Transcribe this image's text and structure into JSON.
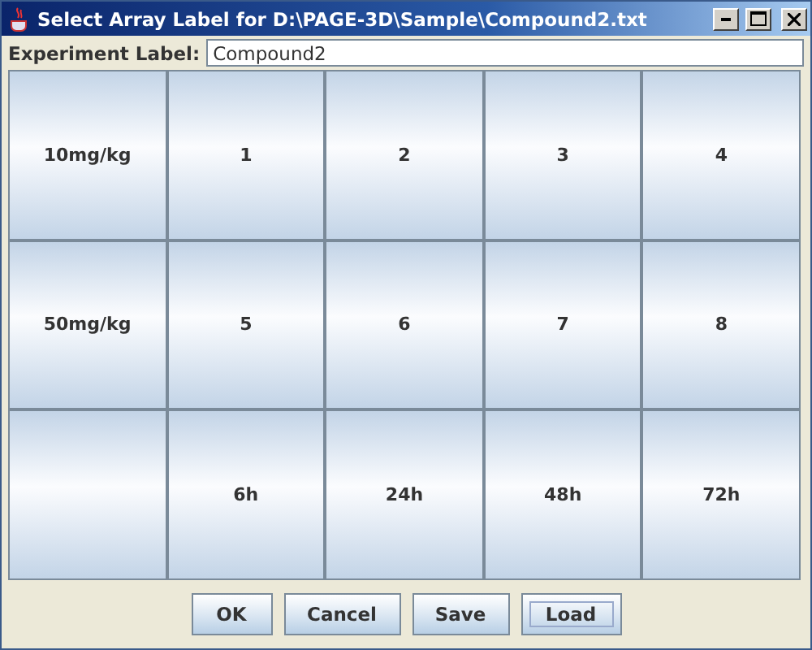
{
  "window": {
    "title": "Select Array Label for D:\\PAGE-3D\\Sample\\Compound2.txt"
  },
  "experiment_label": {
    "label": "Experiment Label:",
    "value": "Compound2"
  },
  "grid": [
    {
      "header": "10mg/kg",
      "cells": [
        "1",
        "2",
        "3",
        "4"
      ]
    },
    {
      "header": "50mg/kg",
      "cells": [
        "5",
        "6",
        "7",
        "8"
      ]
    },
    {
      "cells": [
        "6h",
        "24h",
        "48h",
        "72h"
      ]
    }
  ],
  "buttons": [
    {
      "label": "OK",
      "focused": false
    },
    {
      "label": "Cancel",
      "focused": false
    },
    {
      "label": "Save",
      "focused": false
    },
    {
      "label": "Load",
      "focused": true
    }
  ]
}
